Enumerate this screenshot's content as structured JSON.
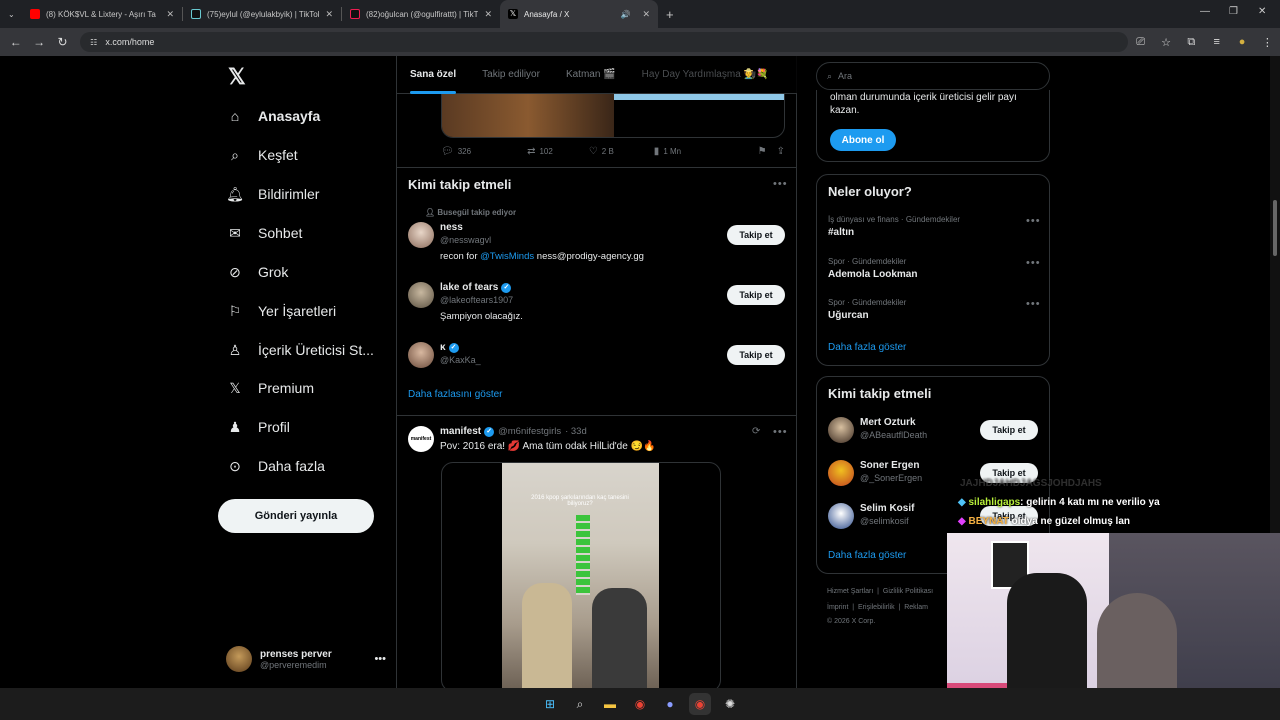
{
  "browser": {
    "tabs": [
      {
        "label": "(8) KÖK$VL & Lixtery - Aşırı Tan",
        "active": false
      },
      {
        "label": "(75)eylul (@eylulakbyik) | TikTok",
        "active": false
      },
      {
        "label": "(82)oğulcan (@ogulfirattt) | TikT",
        "active": false
      },
      {
        "label": "Anasayfa / X",
        "active": true
      }
    ],
    "url": "x.com/home"
  },
  "nav": {
    "items": [
      {
        "label": "Anasayfa",
        "icon": "home-icon"
      },
      {
        "label": "Keşfet",
        "icon": "search-icon"
      },
      {
        "label": "Bildirimler",
        "icon": "bell-icon"
      },
      {
        "label": "Sohbet",
        "icon": "mail-icon"
      },
      {
        "label": "Grok",
        "icon": "grok-icon"
      },
      {
        "label": "Yer İşaretleri",
        "icon": "bookmark-icon"
      },
      {
        "label": "İçerik Üreticisi St...",
        "icon": "creator-icon"
      },
      {
        "label": "Premium",
        "icon": "x-premium-icon"
      },
      {
        "label": "Profil",
        "icon": "person-icon"
      },
      {
        "label": "Daha fazla",
        "icon": "more-circle-icon"
      }
    ],
    "post_button": "Gönderi yayınla",
    "profile": {
      "name": "prenses perver",
      "handle": "@perveremedim"
    }
  },
  "center": {
    "tabs": [
      "Sana özel",
      "Takip ediliyor",
      "Katman 🎬",
      "Hay Day Yardımlaşma 🧑‍🌾💐"
    ],
    "post1_actions": {
      "replies": "326",
      "reposts": "102",
      "likes": "2 B",
      "views": "1 Mn"
    },
    "who_to_follow": {
      "title": "Kimi takip etmeli",
      "social_context": "Busegül takip ediyor",
      "follow_label": "Takip et",
      "users": [
        {
          "name": "ness",
          "handle": "@nesswagvl",
          "verified": false,
          "bio_prefix": "recon for ",
          "bio_link": "@TwisMinds",
          "bio_suffix": " ness@prodigy-agency.gg"
        },
        {
          "name": "lake of tears",
          "handle": "@lakeoftears1907",
          "verified": true,
          "bio_prefix": "Şampiyon olacağız.",
          "bio_link": "",
          "bio_suffix": ""
        },
        {
          "name": "κ",
          "handle": "@KaxKa_",
          "verified": true,
          "bio_prefix": "",
          "bio_link": "",
          "bio_suffix": ""
        }
      ],
      "show_more": "Daha fazlasını göster"
    },
    "post2": {
      "name": "manifest",
      "handle": "@m6nifestgirls",
      "time": "· 33d",
      "text": "Pov: 2016 era! 💋 Ama tüm odak HilLid'de 😏🔥",
      "video_caption": "2016 kpop şarkılarından kaç tanesini biliyoruz?"
    }
  },
  "right": {
    "search_placeholder": "Ara",
    "premium_card": {
      "text": "olman durumunda içerik üreticisi gelir payı kazan.",
      "button": "Abone ol"
    },
    "trends": {
      "title": "Neler oluyor?",
      "items": [
        {
          "category": "İş dünyası ve finans · Gündemdekiler",
          "title": "#altın"
        },
        {
          "category": "Spor · Gündemdekiler",
          "title": "Ademola Lookman"
        },
        {
          "category": "Spor · Gündemdekiler",
          "title": "Uğurcan"
        }
      ],
      "show_more": "Daha fazla göster"
    },
    "who_to_follow": {
      "title": "Kimi takip etmeli",
      "follow_label": "Takip et",
      "users": [
        {
          "name": "Mert Ozturk",
          "handle": "@ABeautflDeath"
        },
        {
          "name": "Soner Ergen",
          "handle": "@_SonerErgen"
        },
        {
          "name": "Selim Kosif",
          "handle": "@selimkosif"
        }
      ],
      "show_more": "Daha fazla göster"
    },
    "footer": [
      "Hizmet Şartları",
      "Gizlilik Politikası",
      "İmprint",
      "Erişilebilirlik",
      "Reklam",
      "© 2026 X Corp."
    ]
  },
  "overlay": {
    "chat": [
      {
        "user": "silahligaps",
        "message": ": gelirin 4 katı mı ne verilio ya"
      },
      {
        "user": "BEYNAT",
        "message": " oldya ne güzel olmuş lan"
      }
    ],
    "faded_line": "JAJHDJAHDJAGSJOHDJAHS"
  },
  "colors": {
    "accent": "#1d9bf0",
    "background": "#000000",
    "border": "#2f3336",
    "muted": "#71767b"
  }
}
